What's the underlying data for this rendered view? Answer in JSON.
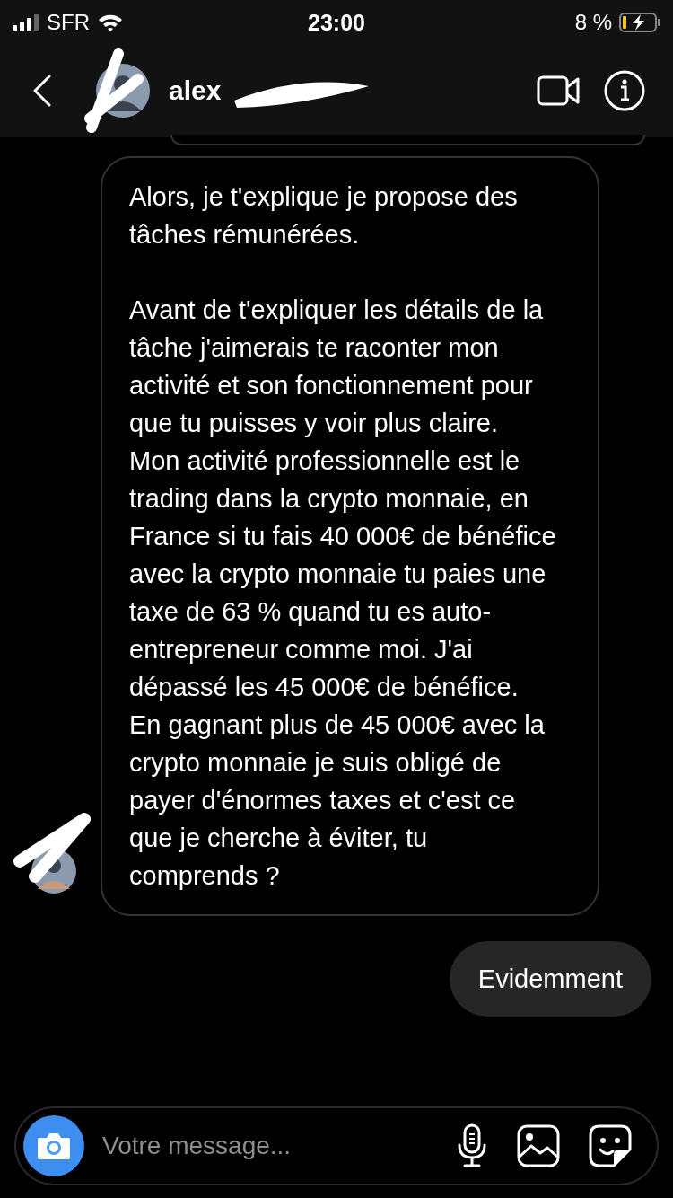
{
  "status_bar": {
    "carrier": "SFR",
    "time": "23:00",
    "battery": "8 %"
  },
  "header": {
    "name": "alex"
  },
  "messages": [
    {
      "kind": "received",
      "paragraphs": [
        "Alors, je t'explique je propose des tâches rémunérées.",
        "Avant de t'expliquer les détails de la tâche j'aimerais te raconter mon activité et son fonctionnement pour que tu puisses y voir plus claire.",
        "Mon activité professionnelle est le trading dans la crypto monnaie, en France si tu fais 40 000€ de bénéfice avec la crypto monnaie tu paies une taxe de 63 % quand tu es auto-entrepreneur comme moi. J'ai dépassé les 45 000€ de bénéfice.",
        "En gagnant plus de 45 000€ avec la crypto monnaie je suis obligé de payer d'énormes taxes et c'est ce que je cherche à éviter, tu comprends ?"
      ],
      "gap_after_first": true
    },
    {
      "kind": "sent",
      "paragraphs": [
        "Evidemment"
      ]
    }
  ],
  "composer": {
    "placeholder": "Votre message..."
  }
}
